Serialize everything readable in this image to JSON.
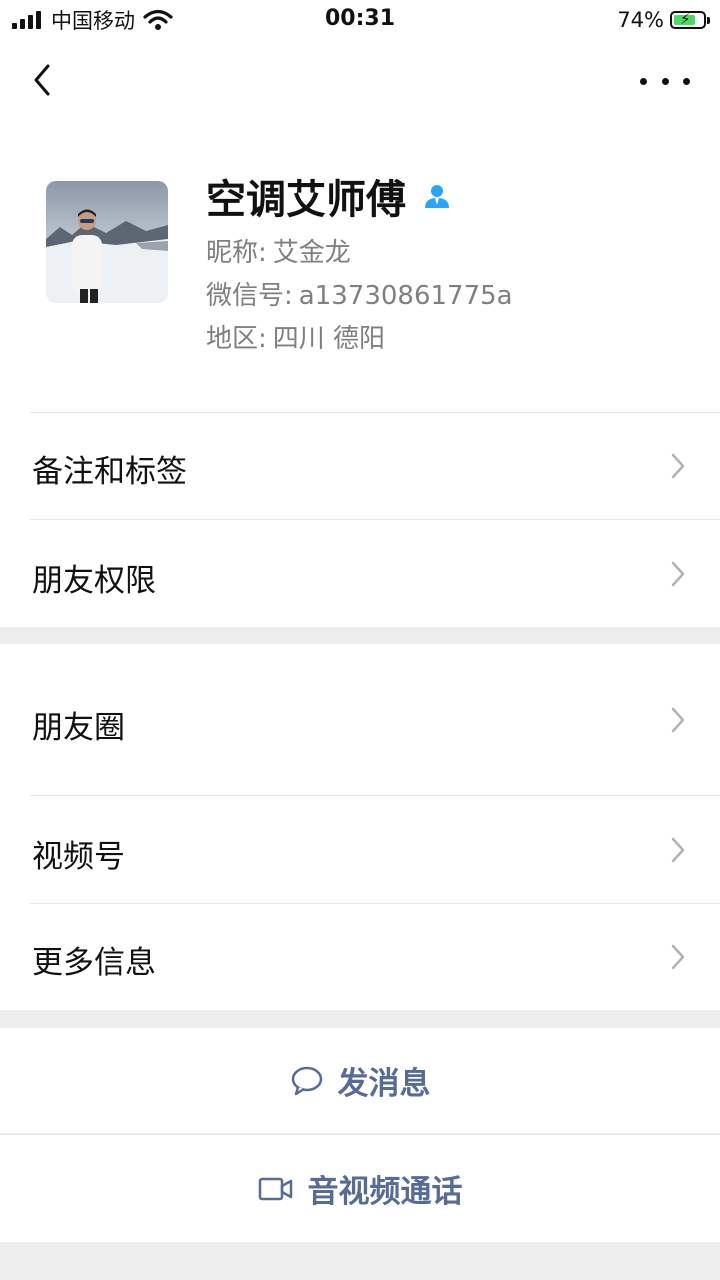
{
  "status_bar": {
    "carrier": "中国移动",
    "time": "00:31",
    "battery_percent": "74%",
    "battery_level": 0.74,
    "signal_bars": 4
  },
  "nav": {
    "back_icon": "chevron-left-icon",
    "more_icon": "ellipsis-icon"
  },
  "profile": {
    "name": "空调艾师傅",
    "nickname_label": "昵称:",
    "nickname": "艾金龙",
    "wechat_id_label": "微信号:",
    "wechat_id": "a13730861775a",
    "region_label": "地区:",
    "region": "四川 德阳",
    "verify_icon": "person-icon",
    "verify_color": "#2aa4f4"
  },
  "menu_group1": [
    {
      "label": "备注和标签"
    },
    {
      "label": "朋友权限"
    }
  ],
  "menu_group2": [
    {
      "label": "朋友圈"
    },
    {
      "label": "视频号"
    },
    {
      "label": "更多信息"
    }
  ],
  "actions": {
    "message_label": "发消息",
    "call_label": "音视频通话",
    "accent_color": "#576b95"
  }
}
